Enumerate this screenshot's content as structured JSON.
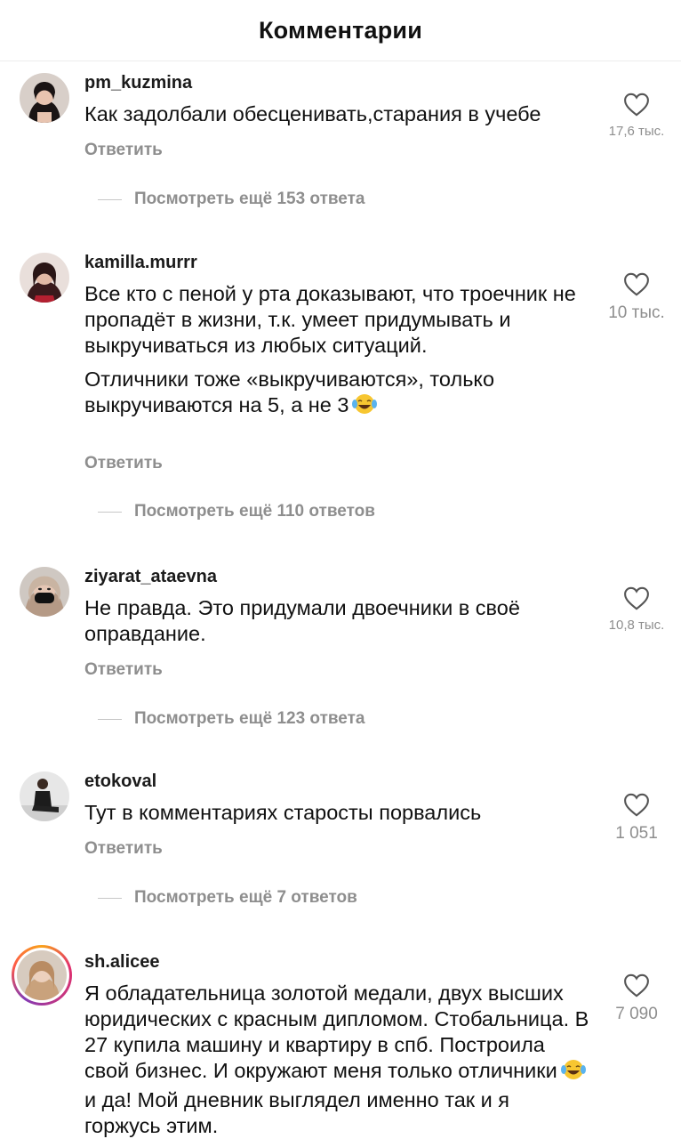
{
  "header": {
    "title": "Комментарии"
  },
  "comments": [
    {
      "username": "pm_kuzmina",
      "paragraphs": [
        "Как задолбали обесценивать,старания в учебе"
      ],
      "reply_label": "Ответить",
      "likes": "17,6 тыс.",
      "view_more": "Посмотреть ещё 153 ответа"
    },
    {
      "username": "kamilla.murrr",
      "paragraphs": [
        "Все кто с пеной у рта доказывают, что троечник не пропадёт в жизни, т.к. умеет придумывать и выкручиваться из любых ситуаций.",
        "Отличники тоже «выкручиваются», только выкручиваются на 5, а не 3"
      ],
      "reply_label": "Ответить",
      "likes": "10 тыс.",
      "view_more": "Посмотреть ещё 110 ответов"
    },
    {
      "username": "ziyarat_ataevna",
      "paragraphs": [
        "Не правда. Это придумали двоечники в своё оправдание."
      ],
      "reply_label": "Ответить",
      "likes": "10,8 тыс.",
      "view_more": "Посмотреть ещё 123 ответа"
    },
    {
      "username": "etokoval",
      "paragraphs": [
        "Тут в комментариях старосты порвались"
      ],
      "reply_label": "Ответить",
      "likes": "1 051",
      "view_more": "Посмотреть ещё 7 ответов"
    },
    {
      "username": "sh.alicee",
      "paragraphs": [
        "Я обладательница золотой медали, двух высших юридических с красным дипломом. Стобальница. В 27 купила машину и квартиру в спб. Построила свой бизнес. И окружают меня только отличники",
        "и да! Мой дневник выглядел именно так и я горжусь этим."
      ],
      "reply_label": "",
      "likes": "7 090",
      "view_more": ""
    }
  ],
  "icons": {
    "like": "heart-outline-icon",
    "emoji": "laughing-tears-emoji"
  },
  "colors": {
    "muted_text": "#8e8e8e",
    "story_ring": [
      "#f9a21b",
      "#e1306c",
      "#833ab4"
    ]
  }
}
